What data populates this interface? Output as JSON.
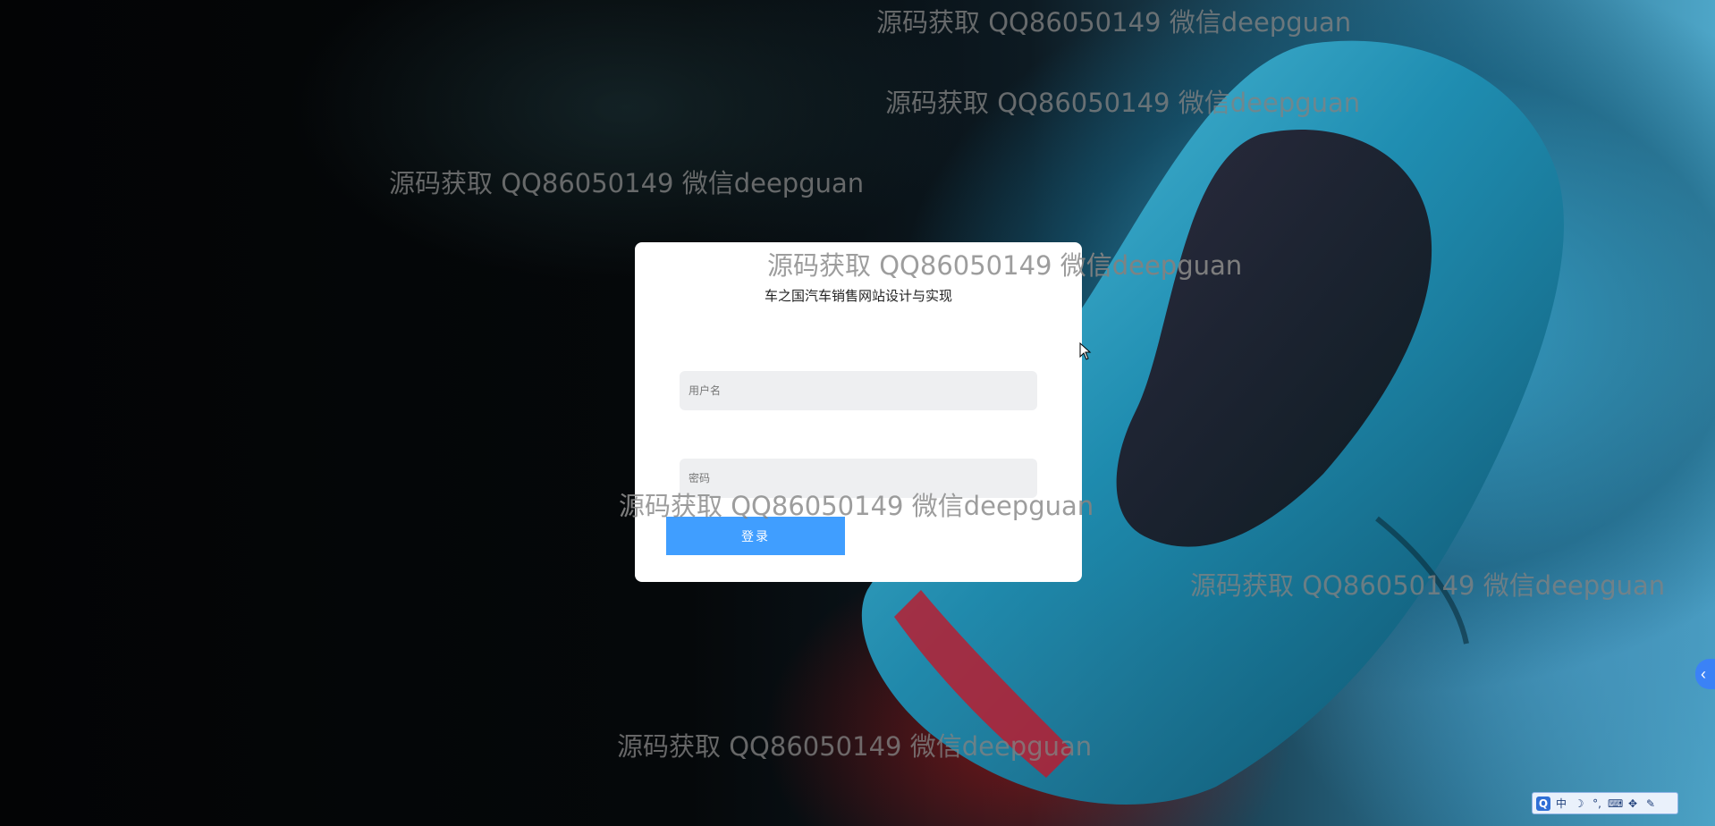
{
  "app": {
    "title": "车之国汽车销售网站设计与实现"
  },
  "login_form": {
    "username_placeholder": "用户名",
    "password_placeholder": "密码",
    "submit_label": "登录"
  },
  "watermarks": [
    "源码获取 QQ86050149 微信deepguan",
    "源码获取 QQ86050149 微信deepguan",
    "源码获取 QQ86050149 微信deepguan",
    "源码获取 QQ86050149 微信deepguan",
    "源码获取 QQ86050149 微信deepguan",
    "源码获取 QQ86050149 微信deepguan",
    "源码获取 QQ86050149 微信deepguan"
  ],
  "side_toggle": {
    "icon": "chevron-left-icon",
    "glyph": "‹"
  },
  "ime_toolbar": {
    "items": [
      {
        "name": "ime-logo-icon",
        "glyph": "Q"
      },
      {
        "name": "ime-chinese-mode",
        "glyph": "中"
      },
      {
        "name": "ime-half-width-icon",
        "glyph": "☽"
      },
      {
        "name": "ime-punctuation-icon",
        "glyph": "°,"
      },
      {
        "name": "ime-keyboard-icon",
        "glyph": "⌨"
      },
      {
        "name": "ime-skin-icon",
        "glyph": "✥"
      },
      {
        "name": "ime-settings-icon",
        "glyph": "✎"
      }
    ]
  },
  "colors": {
    "primary_button": "#409eff",
    "side_toggle": "#3b82f6",
    "card_background": "#ffffff"
  }
}
